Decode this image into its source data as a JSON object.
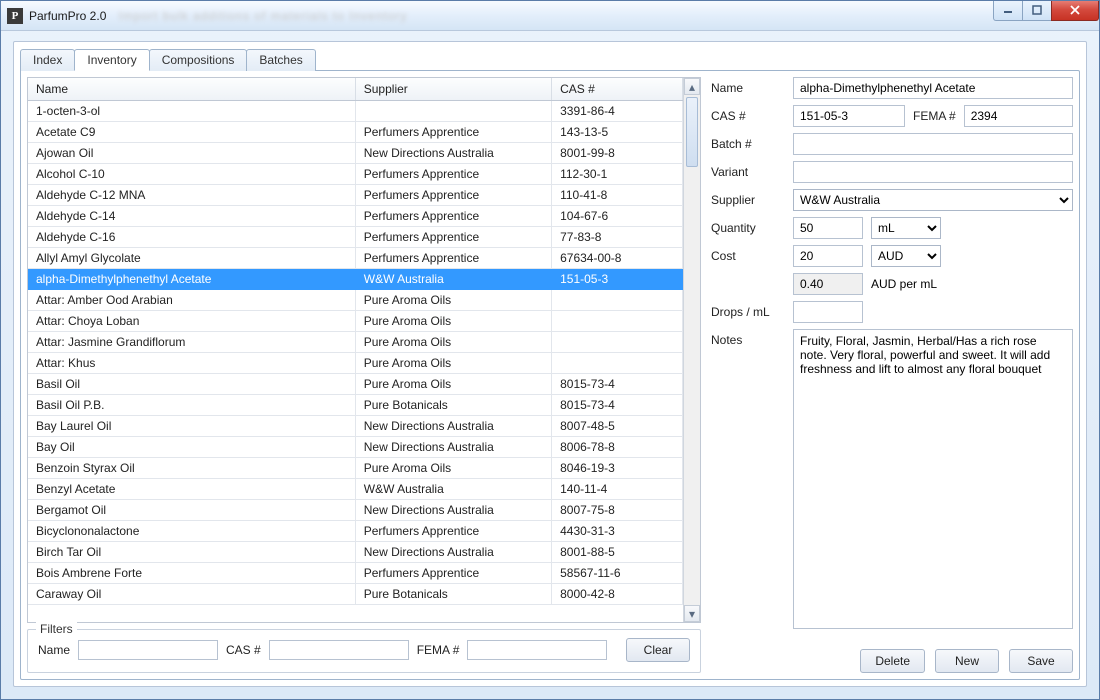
{
  "app": {
    "title": "ParfumPro 2.0"
  },
  "winbuttons": {
    "min": "minimize",
    "max": "maximize",
    "close": "close"
  },
  "tabs": [
    {
      "id": "index",
      "label": "Index"
    },
    {
      "id": "inventory",
      "label": "Inventory",
      "active": true
    },
    {
      "id": "compositions",
      "label": "Compositions"
    },
    {
      "id": "batches",
      "label": "Batches"
    }
  ],
  "table": {
    "columns": {
      "name": "Name",
      "supplier": "Supplier",
      "cas": "CAS #"
    },
    "selected_index": 8,
    "rows": [
      {
        "name": "1-octen-3-ol",
        "supplier": "",
        "cas": "3391-86-4"
      },
      {
        "name": "Acetate C9",
        "supplier": "Perfumers Apprentice",
        "cas": "143-13-5"
      },
      {
        "name": "Ajowan Oil",
        "supplier": "New Directions Australia",
        "cas": "8001-99-8"
      },
      {
        "name": "Alcohol C-10",
        "supplier": "Perfumers Apprentice",
        "cas": "112-30-1"
      },
      {
        "name": "Aldehyde C-12 MNA",
        "supplier": "Perfumers Apprentice",
        "cas": "110-41-8"
      },
      {
        "name": "Aldehyde C-14",
        "supplier": "Perfumers Apprentice",
        "cas": "104-67-6"
      },
      {
        "name": "Aldehyde C-16",
        "supplier": "Perfumers Apprentice",
        "cas": "77-83-8"
      },
      {
        "name": "Allyl Amyl Glycolate",
        "supplier": "Perfumers Apprentice",
        "cas": "67634-00-8"
      },
      {
        "name": "alpha-Dimethylphenethyl Acetate",
        "supplier": "W&W Australia",
        "cas": "151-05-3"
      },
      {
        "name": "Attar: Amber Ood Arabian",
        "supplier": "Pure Aroma Oils",
        "cas": ""
      },
      {
        "name": "Attar: Choya Loban",
        "supplier": "Pure Aroma Oils",
        "cas": ""
      },
      {
        "name": "Attar: Jasmine Grandiflorum",
        "supplier": "Pure Aroma Oils",
        "cas": ""
      },
      {
        "name": "Attar: Khus",
        "supplier": "Pure Aroma Oils",
        "cas": ""
      },
      {
        "name": "Basil Oil",
        "supplier": "Pure Aroma Oils",
        "cas": "8015-73-4"
      },
      {
        "name": "Basil Oil P.B.",
        "supplier": "Pure Botanicals",
        "cas": "8015-73-4"
      },
      {
        "name": "Bay Laurel Oil",
        "supplier": "New Directions Australia",
        "cas": "8007-48-5"
      },
      {
        "name": "Bay Oil",
        "supplier": "New Directions Australia",
        "cas": "8006-78-8"
      },
      {
        "name": "Benzoin Styrax Oil",
        "supplier": "Pure Aroma Oils",
        "cas": "8046-19-3"
      },
      {
        "name": "Benzyl Acetate",
        "supplier": "W&W Australia",
        "cas": "140-11-4"
      },
      {
        "name": "Bergamot Oil",
        "supplier": "New Directions Australia",
        "cas": "8007-75-8"
      },
      {
        "name": "Bicyclononalactone",
        "supplier": "Perfumers Apprentice",
        "cas": "4430-31-3"
      },
      {
        "name": "Birch Tar Oil",
        "supplier": "New Directions Australia",
        "cas": "8001-88-5"
      },
      {
        "name": "Bois Ambrene Forte",
        "supplier": "Perfumers Apprentice",
        "cas": "58567-11-6"
      },
      {
        "name": "Caraway Oil",
        "supplier": "Pure Botanicals",
        "cas": "8000-42-8"
      }
    ]
  },
  "filters": {
    "legend": "Filters",
    "name_label": "Name",
    "cas_label": "CAS #",
    "fema_label": "FEMA #",
    "clear": "Clear",
    "name_value": "",
    "cas_value": "",
    "fema_value": ""
  },
  "detail": {
    "labels": {
      "name": "Name",
      "cas": "CAS #",
      "fema": "FEMA #",
      "batch": "Batch #",
      "variant": "Variant",
      "supplier": "Supplier",
      "quantity": "Quantity",
      "cost": "Cost",
      "drops": "Drops / mL",
      "notes": "Notes",
      "per_unit_suffix": "AUD per mL"
    },
    "values": {
      "name": "alpha-Dimethylphenethyl Acetate",
      "cas": "151-05-3",
      "fema": "2394",
      "batch": "",
      "variant": "",
      "supplier": "W&W Australia",
      "quantity": "50",
      "quantity_unit": "mL",
      "cost": "20",
      "cost_currency": "AUD",
      "per_unit": "0.40",
      "drops": "",
      "notes": "Fruity, Floral, Jasmin, Herbal/Has a rich rose note. Very floral, powerful and sweet. It will add freshness and lift to almost any floral bouquet"
    },
    "buttons": {
      "delete": "Delete",
      "new": "New",
      "save": "Save"
    }
  }
}
